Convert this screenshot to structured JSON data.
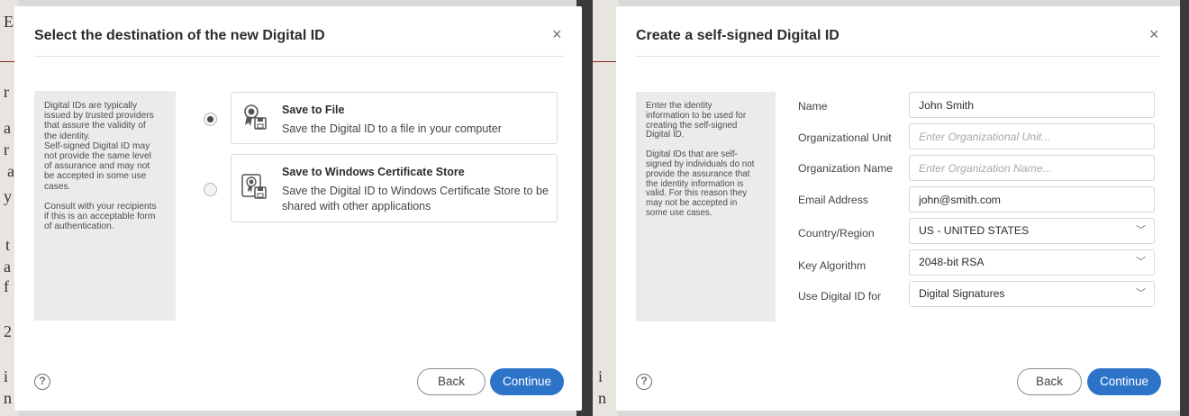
{
  "left_dialog": {
    "title": "Select the destination of the new Digital ID",
    "close_glyph": "×",
    "info_paragraphs": [
      "Digital IDs are typically\nissued by trusted providers\nthat assure the validity of\nthe identity.\nSelf-signed Digital ID may\nnot provide the same level\nof assurance and may not\nbe accepted in some use\ncases.",
      "Consult with your recipients\nif this is an acceptable form\nof authentication."
    ],
    "options": [
      {
        "title": "Save to File",
        "description": "Save the Digital ID to a file in your computer",
        "selected": true,
        "icon": "certificate-save-icon"
      },
      {
        "title": "Save to Windows Certificate Store",
        "description": "Save the Digital ID to Windows Certificate Store to be shared with other applications",
        "selected": false,
        "icon": "certificate-store-icon"
      }
    ],
    "help_glyph": "?",
    "back_label": "Back",
    "continue_label": "Continue"
  },
  "right_dialog": {
    "title": "Create a self-signed Digital ID",
    "close_glyph": "×",
    "info_paragraphs": [
      "Enter the identity\ninformation to be used for\ncreating the self-signed\nDigital ID.",
      "Digital IDs that are self-\nsigned by individuals do not\nprovide the assurance that\nthe identity information is\nvalid. For this reason they\nmay not be accepted in\nsome use cases."
    ],
    "fields": {
      "name": {
        "label": "Name",
        "value": "John Smith",
        "placeholder": ""
      },
      "org_unit": {
        "label": "Organizational Unit",
        "value": "",
        "placeholder": "Enter Organizational Unit..."
      },
      "org_name": {
        "label": "Organization Name",
        "value": "",
        "placeholder": "Enter Organization Name..."
      },
      "email": {
        "label": "Email Address",
        "value": "john@smith.com",
        "placeholder": ""
      },
      "country": {
        "label": "Country/Region",
        "value": "US - UNITED STATES"
      },
      "key_algorithm": {
        "label": "Key Algorithm",
        "value": "2048-bit RSA"
      },
      "use_for": {
        "label": "Use Digital ID for",
        "value": "Digital Signatures"
      }
    },
    "chevron_glyph": "﹀",
    "help_glyph": "?",
    "back_label": "Back",
    "continue_label": "Continue"
  },
  "background_doc_chars": [
    "E",
    "r",
    "a",
    "r",
    "a",
    "y",
    "t",
    "a",
    "f",
    "2",
    "i",
    "n",
    "i",
    "n"
  ],
  "colors": {
    "accent": "#2d74c9",
    "info_bg": "#ebebeb",
    "doc_rule": "#8a2a1e"
  }
}
